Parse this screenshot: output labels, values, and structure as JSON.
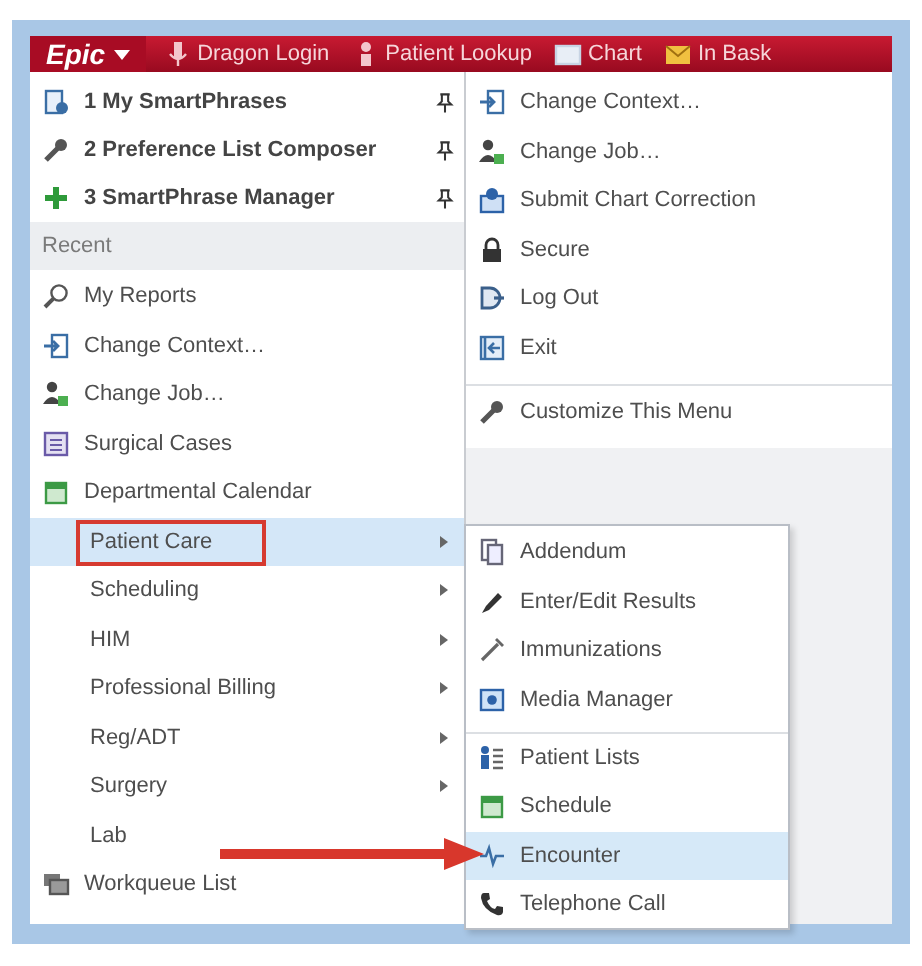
{
  "toolbar": {
    "menu_button": "Epic",
    "items": [
      {
        "label": "Dragon Login"
      },
      {
        "label": "Patient Lookup"
      },
      {
        "label": "Chart"
      },
      {
        "label": "In Bask"
      }
    ]
  },
  "pinned": [
    {
      "label": "1 My SmartPhrases",
      "pinned": true
    },
    {
      "label": "2 Preference List Composer",
      "pinned": true
    },
    {
      "label": "3 SmartPhrase Manager",
      "pinned": true
    }
  ],
  "recent_heading": "Recent",
  "recent": [
    {
      "label": "My Reports"
    },
    {
      "label": "Change Context…"
    },
    {
      "label": "Change Job…"
    },
    {
      "label": "Surgical Cases"
    },
    {
      "label": "Departmental Calendar"
    }
  ],
  "activities": [
    {
      "label": "Patient Care",
      "selected": true,
      "has_submenu": true,
      "annotated": true
    },
    {
      "label": "Scheduling",
      "selected": false,
      "has_submenu": true,
      "annotated": false
    },
    {
      "label": "HIM",
      "selected": false,
      "has_submenu": true,
      "annotated": false
    },
    {
      "label": "Professional Billing",
      "selected": false,
      "has_submenu": true,
      "annotated": false
    },
    {
      "label": "Reg/ADT",
      "selected": false,
      "has_submenu": true,
      "annotated": false
    },
    {
      "label": "Surgery",
      "selected": false,
      "has_submenu": true,
      "annotated": false
    },
    {
      "label": "Lab",
      "selected": false,
      "has_submenu": false,
      "annotated": false
    }
  ],
  "workqueue": "Workqueue List",
  "actions": [
    {
      "label": "Change Context…"
    },
    {
      "label": "Change Job…"
    },
    {
      "label": "Submit Chart Correction"
    },
    {
      "label": "Secure"
    },
    {
      "label": "Log Out"
    },
    {
      "label": "Exit"
    }
  ],
  "customize": "Customize This Menu",
  "submenu": [
    {
      "label": "Addendum",
      "selected": false,
      "group_start": false,
      "annotated": false
    },
    {
      "label": "Enter/Edit Results",
      "selected": false,
      "group_start": false,
      "annotated": false
    },
    {
      "label": "Immunizations",
      "selected": false,
      "group_start": false,
      "annotated": false
    },
    {
      "label": "Media Manager",
      "selected": false,
      "group_start": false,
      "annotated": false
    },
    {
      "label": "Patient Lists",
      "selected": false,
      "group_start": true,
      "annotated": false
    },
    {
      "label": "Schedule",
      "selected": false,
      "group_start": false,
      "annotated": false
    },
    {
      "label": "Encounter",
      "selected": true,
      "group_start": false,
      "annotated": true
    },
    {
      "label": "Telephone Call",
      "selected": false,
      "group_start": false,
      "annotated": false
    }
  ]
}
